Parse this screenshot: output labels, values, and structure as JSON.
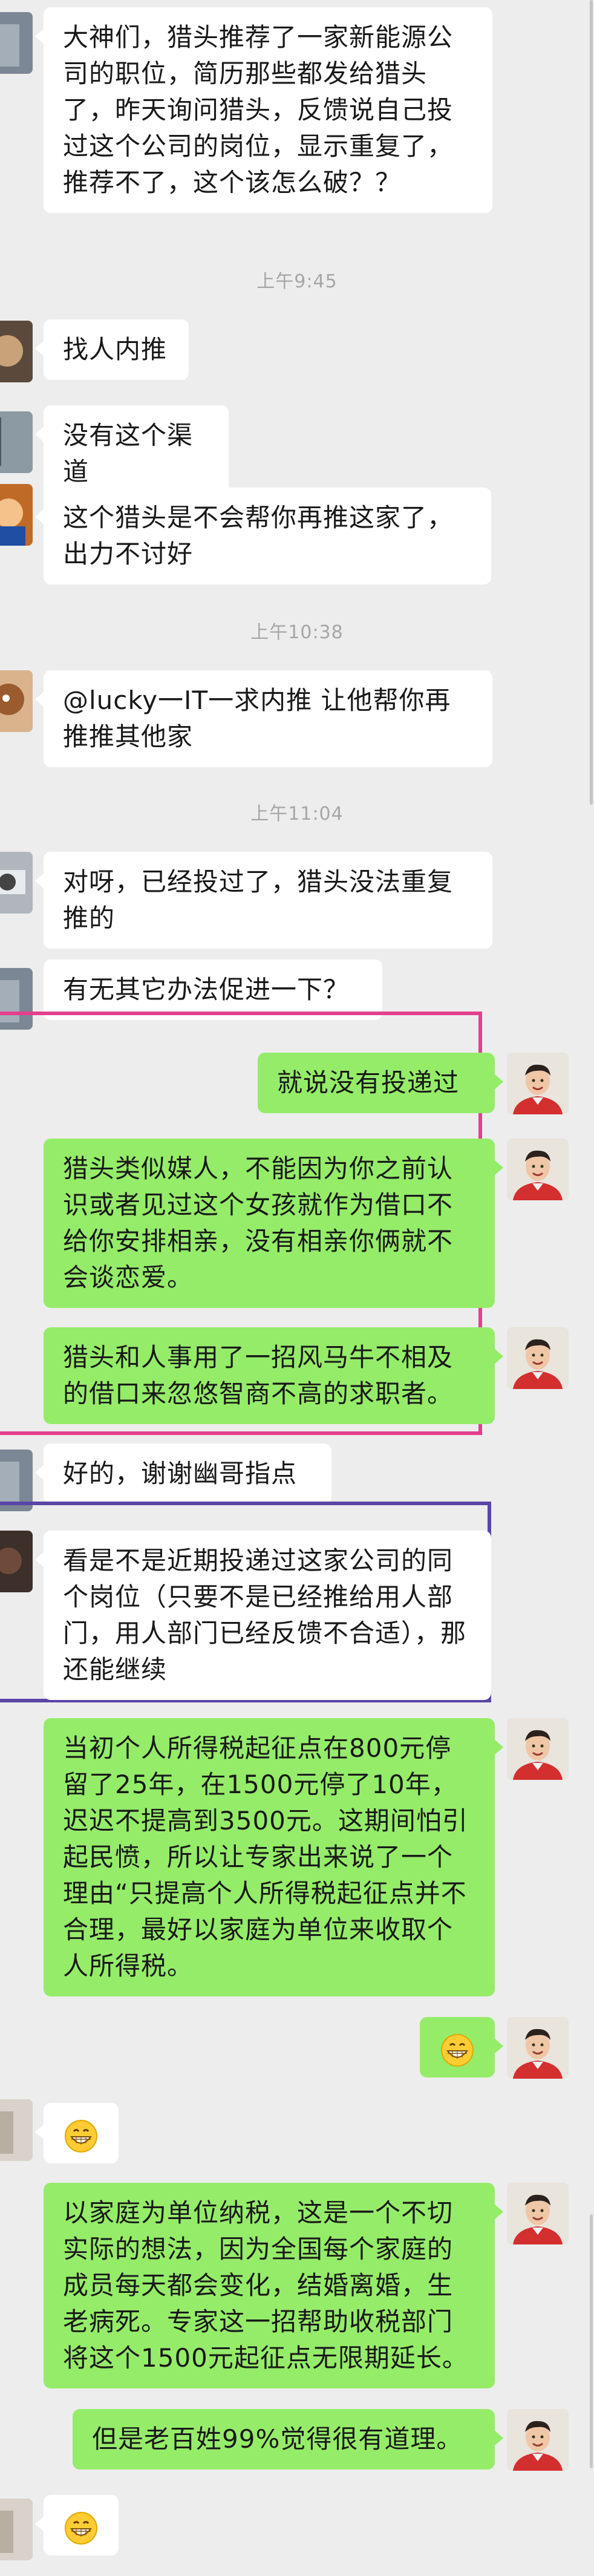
{
  "messages": {
    "m1": "大神们，猎头推荐了一家新能源公司的职位，简历那些都发给猎头了，昨天询问猎头，反馈说自己投过这个公司的岗位，显示重复了，推荐不了，这个该怎么破？？",
    "m2": "找人内推",
    "m3": "没有这个渠道",
    "m4": "这个猎头是不会帮你再推这家了，出力不讨好",
    "m5": "@lucky一IT一求内推  让他帮你再推推其他家",
    "m6": "对呀，已经投过了，猎头没法重复推的",
    "m7": "有无其它办法促进一下？",
    "m8": "就说没有投递过",
    "m9": "猎头类似媒人，不能因为你之前认识或者见过这个女孩就作为借口不给你安排相亲，没有相亲你俩就不会谈恋爱。",
    "m10": "猎头和人事用了一招风马牛不相及的借口来忽悠智商不高的求职者。",
    "m11": "好的，谢谢幽哥指点",
    "m12": "看是不是近期投递过这家公司的同个岗位（只要不是已经推给用人部门，用人部门已经反馈不合适），那还能继续",
    "m13": "当初个人所得税起征点在800元停留了25年，在1500元停了10年，迟迟不提高到3500元。这期间怕引起民愤，所以让专家出来说了一个理由“只提高个人所得税起征点并不合理，最好以家庭为单位来收取个人所得税。",
    "m16": "以家庭为单位纳税，这是一个不切实际的想法，因为全国每个家庭的成员每天都会变化，结婚离婚，生老病死。专家这一招帮助收税部门将这个1500元起征点无限期延长。",
    "m17": "但是老百姓99%觉得很有道理。"
  },
  "times": {
    "t1": "上午9:45",
    "t2": "上午10:38",
    "t3": "上午11:04"
  },
  "emoji_names": [
    "grinning-face-icon",
    "grinning-face-icon",
    "grinning-face-icon"
  ],
  "colors": {
    "self_bubble": "#95ec69",
    "other_bubble": "#ffffff",
    "background": "#ededed",
    "highlight_pink": "#e33f8c",
    "highlight_purple": "#5a45a6"
  }
}
